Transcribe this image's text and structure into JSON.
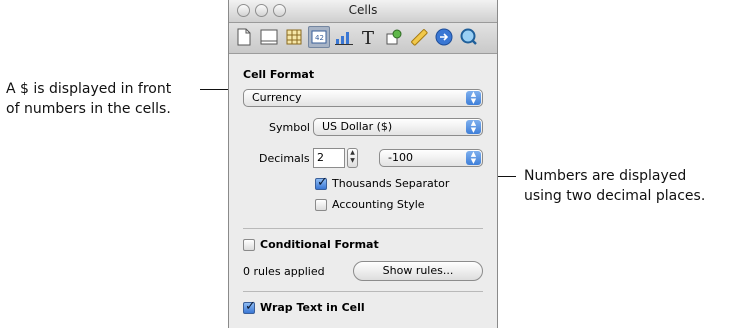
{
  "window": {
    "title": "Cells"
  },
  "toolbar": {
    "icons": [
      "document-icon",
      "layout-icon",
      "table-icon",
      "cells-icon",
      "chart-icon",
      "text-icon",
      "graphic-icon",
      "metrics-icon",
      "link-icon",
      "quicktime-icon"
    ],
    "selected": "cells-icon"
  },
  "cell_format": {
    "heading": "Cell Format",
    "format_value": "Currency",
    "symbol_label": "Symbol",
    "symbol_value": "US Dollar ($)",
    "decimals_label": "Decimals",
    "decimals_value": "2",
    "negative_value": "-100",
    "thousands_label": "Thousands Separator",
    "thousands_checked": true,
    "accounting_label": "Accounting Style",
    "accounting_checked": false
  },
  "conditional": {
    "label": "Conditional Format",
    "checked": false,
    "rules_text": "0 rules applied",
    "show_rules_label": "Show rules..."
  },
  "wrap": {
    "label": "Wrap Text in Cell",
    "checked": true
  },
  "callouts": {
    "left_line1": "A $ is displayed in front",
    "left_line2": "of numbers in the cells.",
    "right_line1": "Numbers are displayed",
    "right_line2": "using two decimal places."
  },
  "colors": {
    "selection_blue": "#3f7fd9",
    "panel_bg": "#ececec"
  }
}
